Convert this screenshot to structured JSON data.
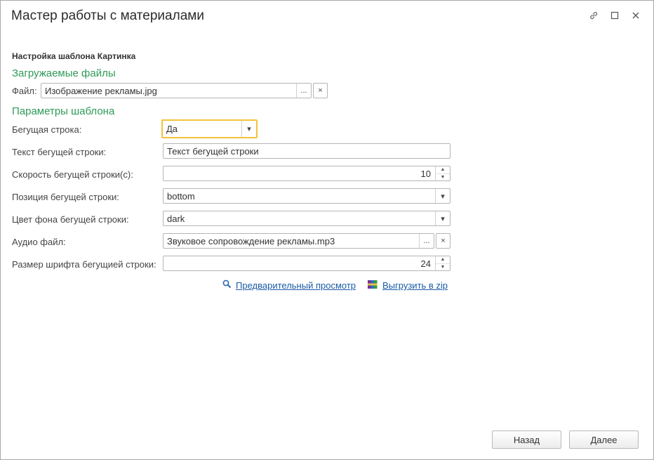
{
  "window": {
    "title": "Мастер работы с материалами"
  },
  "titlebar": {
    "link_icon": "link-icon",
    "maximize_icon": "maximize-icon",
    "close_icon": "close-icon"
  },
  "form": {
    "section_title": "Настройка шаблона Картинка",
    "files_group": "Загружаемые файлы",
    "file_label": "Файл:",
    "file_value": "Изображение рекламы.jpg",
    "params_group": "Параметры шаблона",
    "ticker_label": "Бегущая строка:",
    "ticker_value": "Да",
    "ticker_text_label": "Текст бегущей строки:",
    "ticker_text_value": "Текст бегущей строки",
    "speed_label": "Скорость бегущей строки(с):",
    "speed_value": "10",
    "position_label": "Позиция бегущей строки:",
    "position_value": "bottom",
    "bgcolor_label": "Цвет фона бегущей строки:",
    "bgcolor_value": "dark",
    "audio_label": "Аудио файл:",
    "audio_value": "Звуковое сопровождение рекламы.mp3",
    "fontsize_label": "Размер шрифта бегущией строки:",
    "fontsize_value": "24",
    "browse_label": "...",
    "clear_label": "×",
    "dropdown_arrow": "▾",
    "spin_up": "▲",
    "spin_down": "▼"
  },
  "links": {
    "preview": "Предварительный просмотр",
    "export_zip": "Выгрузить в zip"
  },
  "footer": {
    "back": "Назад",
    "next": "Далее"
  },
  "colors": {
    "group_title": "#2e9a57",
    "link": "#1b5ba6",
    "focus": "#f4c23a"
  }
}
